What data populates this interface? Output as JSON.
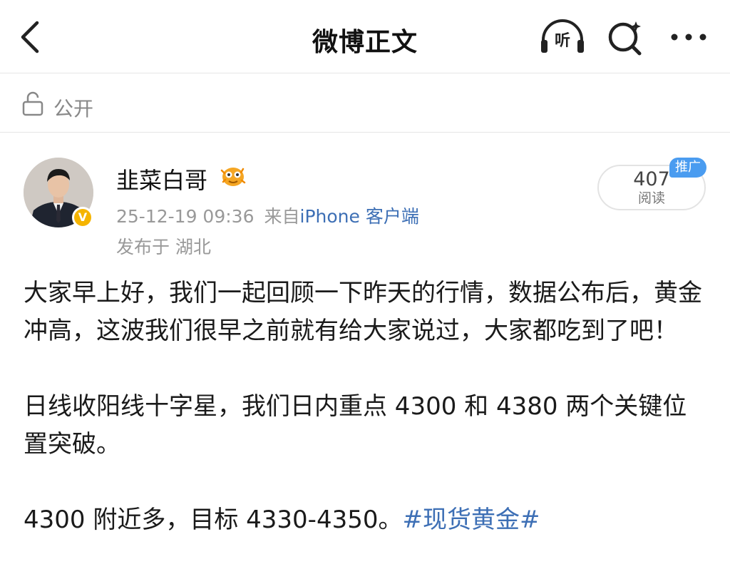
{
  "navbar": {
    "title": "微博正文",
    "listen_label": "听",
    "icons": [
      "back-arrow-icon",
      "headphones-icon",
      "search-icon",
      "more-icon"
    ]
  },
  "visibility": {
    "label": "公开",
    "icon": "lock-icon"
  },
  "post": {
    "author": "韭菜白哥",
    "verified_badge": "V",
    "timestamp": "25-12-19 09:36",
    "source_prefix": "来自",
    "source": "iPhone 客户端",
    "location": "发布于 湖北",
    "read_count": "407",
    "read_label": "阅读",
    "promo_tag": "推广",
    "paragraphs": {
      "p1": "大家早上好，我们一起回顾一下昨天的行情，数据公布后，黄金冲高，这波我们很早之前就有给大家说过，大家都吃到了吧！",
      "p2": "日线收阳线十字星，我们日内重点 4300 和 4380 两个关键位置突破。",
      "p3_text": "4300 附近多，目标 4330-4350。",
      "p3_hashtag": "#现货黄金#"
    }
  },
  "colors": {
    "link": "#3d6fb5",
    "badge": "#f5b400",
    "promo": "#4a9cf0",
    "muted_text": "#999999"
  }
}
